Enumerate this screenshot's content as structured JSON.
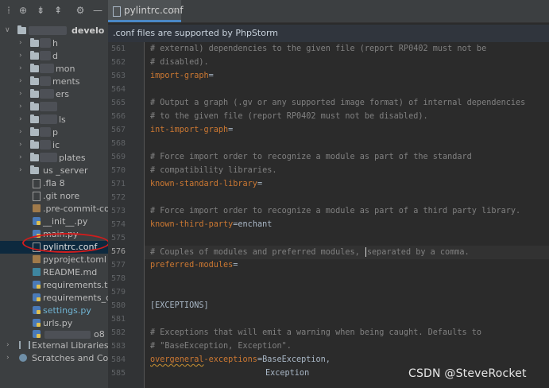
{
  "tab": {
    "label": "pylintrc.conf",
    "close": "×"
  },
  "notice": ".conf files are supported by PhpStorm",
  "project": {
    "root_label": "develo",
    "items": [
      {
        "label": "h"
      },
      {
        "label": "d"
      },
      {
        "label": "mon"
      },
      {
        "label": "ments"
      },
      {
        "label": "ers"
      },
      {
        "label": ""
      },
      {
        "label": "ls"
      },
      {
        "label": "p"
      },
      {
        "label": "ic"
      },
      {
        "label": "plates"
      },
      {
        "label": "us  _server"
      },
      {
        "label": ".fla  8"
      },
      {
        "label": ".git  nore"
      },
      {
        "label": ".pre-commit-cor"
      },
      {
        "label": "__init__.py"
      },
      {
        "label": "main.py"
      },
      {
        "label": "pylintrc.conf"
      },
      {
        "label": "pyproject.toml"
      },
      {
        "label": "README.md"
      },
      {
        "label": "requirements.txt"
      },
      {
        "label": "requirements_de"
      },
      {
        "label": "settings.py"
      },
      {
        "label": "urls.py"
      },
      {
        "label": "o8"
      },
      {
        "label": "External Libraries"
      },
      {
        "label": "Scratches and Cons"
      }
    ]
  },
  "line_numbers": [
    "561",
    "562",
    "563",
    "564",
    "565",
    "566",
    "567",
    "568",
    "569",
    "570",
    "571",
    "572",
    "573",
    "574",
    "575",
    "576",
    "577",
    "578",
    "579",
    "580",
    "581",
    "582",
    "583",
    "584",
    "585"
  ],
  "code": {
    "l561": "# external) dependencies to the given file (report RP0402 must not be",
    "l562": "# disabled).",
    "l563_key": "import-graph",
    "l563_eq": "=",
    "l565": "# Output a graph (.gv or any supported image format) of internal dependencies",
    "l566": "# to the given file (report RP0402 must not be disabled).",
    "l567_key": "int-import-graph",
    "l567_eq": "=",
    "l569": "# Force import order to recognize a module as part of the standard",
    "l570": "# compatibility libraries.",
    "l571_key": "known-standard-library",
    "l571_eq": "=",
    "l573": "# Force import order to recognize a module as part of a third party library.",
    "l574_key": "known-third-party",
    "l574_val": "=enchant",
    "l576_a": "# Couples of modules and preferred modules, ",
    "l576_b": "separated by a comma.",
    "l577_key": "preferred-modules",
    "l577_eq": "=",
    "l580": "[EXCEPTIONS]",
    "l582": "# Exceptions that will emit a warning when being caught. Defaults to",
    "l583": "# \"BaseException, Exception\".",
    "l584_key_a": "overgeneral",
    "l584_key_b": "-exceptions",
    "l584_val": "=BaseException,",
    "l585": "Exception"
  },
  "watermark": "CSDN @SteveRocket"
}
